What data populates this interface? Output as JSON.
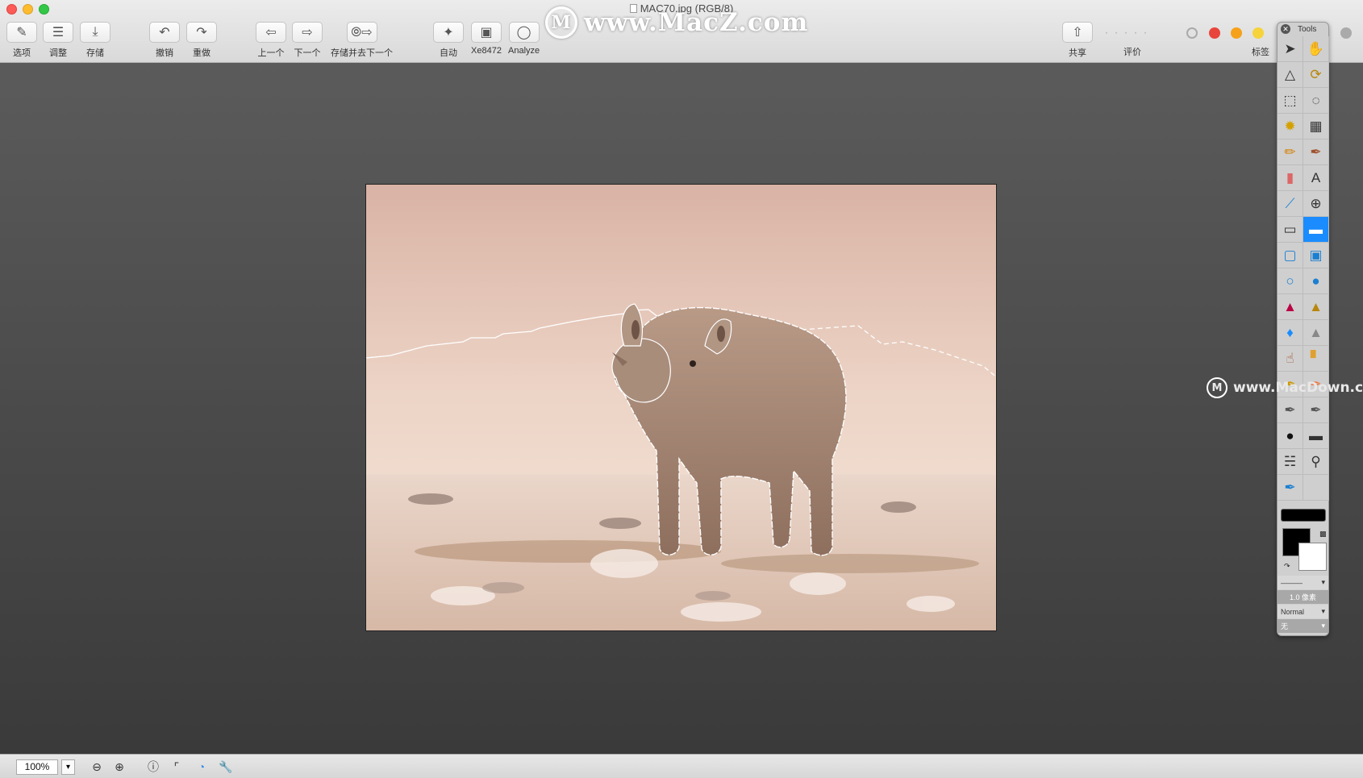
{
  "window": {
    "title": "MAC70.jpg (RGB/8)"
  },
  "toolbar": {
    "left_buttons": [
      {
        "label": "选项",
        "icon": "options-icon"
      },
      {
        "label": "调整",
        "icon": "adjust-icon"
      },
      {
        "label": "存储",
        "icon": "save-icon"
      },
      {
        "label": "撤销",
        "icon": "undo-icon"
      },
      {
        "label": "重做",
        "icon": "redo-icon"
      },
      {
        "label": "上一个",
        "icon": "previous-icon"
      },
      {
        "label": "下一个",
        "icon": "next-icon"
      },
      {
        "label": "存储并去下一个",
        "icon": "save-and-next-icon"
      },
      {
        "label": "自动",
        "icon": "magic-wand-icon"
      },
      {
        "label": "Xe8472",
        "icon": "image-icon"
      },
      {
        "label": "Analyze",
        "icon": "lightbulb-icon"
      }
    ],
    "right_buttons": [
      {
        "label": "共享",
        "icon": "share-icon"
      },
      {
        "label": "评价",
        "icon": "rating-dots-icon"
      },
      {
        "label": "标签",
        "icon": "tag-icon"
      }
    ],
    "tag_colors": [
      "#e8453c",
      "#f6a11a",
      "#f6d33a"
    ]
  },
  "watermarks": {
    "top": "www.MacZ.com",
    "right": "www.MacDown.com"
  },
  "tools_palette": {
    "title": "Tools",
    "tools": [
      "arrow-select-icon",
      "hand-icon",
      "polygon-lasso-icon",
      "lasso-icon",
      "rect-marquee-icon",
      "ellipse-marquee-icon",
      "magic-wand-tool-icon",
      "checker-icon",
      "pencil-icon",
      "brush-icon",
      "eraser-icon",
      "text-icon",
      "line-icon",
      "crosshair-icon",
      "rectangle-icon",
      "filled-rectangle-icon",
      "rounded-rectangle-icon",
      "filled-rounded-rectangle-icon",
      "ellipse-icon",
      "filled-ellipse-icon",
      "paint-bucket-icon",
      "stamp-icon",
      "blur-drop-icon",
      "sharpen-cone-icon",
      "smudge-finger-icon",
      "bandage-icon",
      "dodge-icon",
      "burn-icon",
      "eyedropper-icon",
      "color-brush-icon",
      "silhouette-icon",
      "ruler-icon",
      "spray-icon",
      "magnifier-icon",
      "dropper-clear-icon",
      "empty-slot"
    ],
    "selected_index": 15,
    "stroke_width": "1.0 像素",
    "blend_mode": "Normal",
    "fill_option": "无",
    "foreground_color": "#000000",
    "background_color": "#ffffff"
  },
  "statusbar": {
    "zoom": "100%",
    "icons": [
      "zoom-out-icon",
      "zoom-in-icon",
      "info-icon",
      "crop-icon",
      "web-icon",
      "wrench-icon"
    ]
  }
}
